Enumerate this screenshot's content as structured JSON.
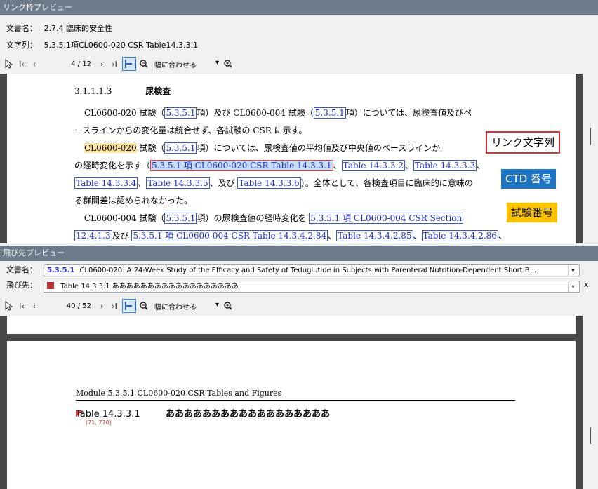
{
  "top_panel": {
    "title": "リンク枠プレビュー",
    "doc_label": "文書名：",
    "doc_value": "2.7.4 臨床的安全性",
    "text_label": "文字列：",
    "text_value": "5.3.5.1項CL0600-020 CSR Table14.3.3.1",
    "toolbar": {
      "page": "4 / 12",
      "zoom": "幅に合わせる"
    },
    "page": {
      "heading_num": "3.1.1.1.3",
      "heading_title": "尿検査",
      "l1a": "CL0600-020 試験（",
      "l1b": "5.3.5.1",
      "l1c": "項）及び CL0600-004 試験（",
      "l1d": "5.3.5.1",
      "l1e": "項）については、尿検査値及びベ",
      "l2": "ースラインからの変化量は統合せず、各試験の CSR に示す。",
      "l3a": "CL0600-020",
      "l3b": " 試験（",
      "l3c": "5.3.5.1",
      "l3d": "項）については、尿検査値の平均値及び中央値のベースラインか",
      "l4a": "の経時変化を示す（",
      "l4b": "5.3.5.1 項 CL0600-020 CSR Table 14.3.3.1",
      "l4c": "、",
      "l4d": "Table 14.3.3.2",
      "l4e": "、",
      "l4f": "Table 14.3.3.3",
      "l4g": "、",
      "l5a": "Table 14.3.3.4",
      "l5b": "、",
      "l5c": "Table 14.3.3.5",
      "l5d": "、及び ",
      "l5e": "Table 14.3.3.6",
      "l5f": "）。全体として、各検査項目に臨床的に意味の",
      "l6": "る群間差は認められなかった。",
      "l7a": "CL0600-004 試験（",
      "l7b": "5.3.5.1",
      "l7c": "項）の尿検査値の経時変化を ",
      "l7d": "5.3.5.1 項 CL0600-004 CSR Section",
      "l8a": "12.4.1.3",
      "l8b": "及び ",
      "l8c": "5.3.5.1 項 CL0600-004 CSR Table 14.3.4.2.84",
      "l8d": "、",
      "l8e": "Table 14.3.4.2.85",
      "l8f": "、",
      "l8g": "Table 14.3.4.2.86",
      "l8h": "、"
    },
    "callouts": {
      "link_text": "リンク文字列",
      "ctd": "CTD 番号",
      "study": "試験番号"
    }
  },
  "bottom_panel": {
    "title": "飛び先プレビュー",
    "doc_label": "文書名：",
    "doc_bold": "5.3.5.1",
    "doc_rest": "CL0600-020: A 24-Week Study of the Efficacy and Safety of Teduglutide in Subjects with Parenteral Nutrition-Dependent Short B...",
    "dest_label": "飛び先：",
    "dest_value": "Table 14.3.3.1 ああああああああああああああああああ",
    "close": "x",
    "toolbar": {
      "page": "40 / 52",
      "zoom": "幅に合わせる"
    },
    "page": {
      "header": "Module 5.3.5.1 CL0600-020 CSR Tables and Figures",
      "table_id": "Table 14.3.3.1",
      "table_title": "ああああああああああああああああああ",
      "coord": "(71, 770)"
    }
  }
}
